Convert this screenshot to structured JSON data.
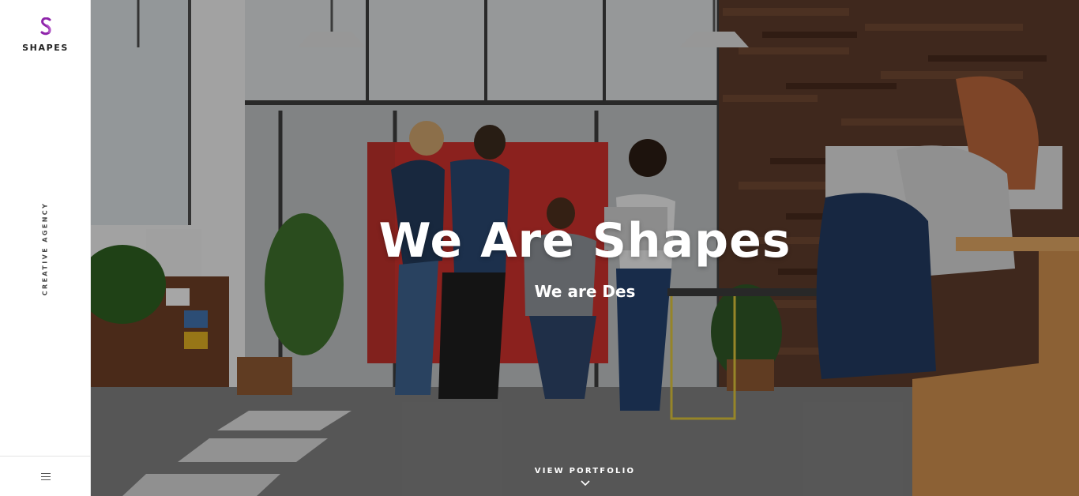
{
  "brand": {
    "name": "SHAPES",
    "tagline": "CREATIVE AGENCY",
    "accent_color": "#8e24aa"
  },
  "hero": {
    "title": "We Are Shapes",
    "subtitle": "We are Des",
    "cta_label": "VIEW PORTFOLIO",
    "background_image": "office-team-photo"
  },
  "icons": {
    "logo": "s-logo-icon",
    "menu": "hamburger-menu-icon",
    "cta": "chevron-down-icon"
  }
}
